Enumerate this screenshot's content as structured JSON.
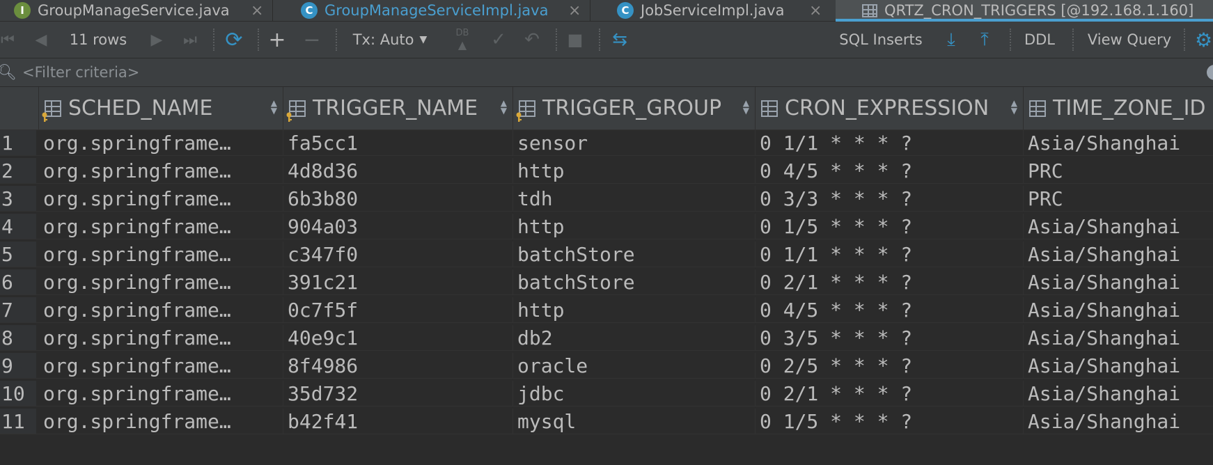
{
  "tabs": [
    {
      "badge": "I",
      "label": "GroupManageService.java"
    },
    {
      "badge": "C",
      "label": "GroupManageServiceImpl.java"
    },
    {
      "badge": "C",
      "label": "JobServiceImpl.java"
    },
    {
      "badge": "",
      "label": "QRTZ_CRON_TRIGGERS [@192.168.1.160]"
    }
  ],
  "toolbar": {
    "rows": "11 rows",
    "tx_mode": "Tx: Auto",
    "db_label": "DB",
    "sql_inserts": "SQL Inserts",
    "ddl": "DDL",
    "view_query": "View Query"
  },
  "filter": {
    "placeholder": "<Filter criteria>"
  },
  "columns": [
    "SCHED_NAME",
    "TRIGGER_NAME",
    "TRIGGER_GROUP",
    "CRON_EXPRESSION",
    "TIME_ZONE_ID"
  ],
  "rows": [
    {
      "n": "1",
      "cells": [
        "org.springframe…",
        "fa5cc1",
        "sensor",
        "0 1/1 * * * ?",
        "Asia/Shanghai"
      ]
    },
    {
      "n": "2",
      "cells": [
        "org.springframe…",
        "4d8d36",
        "http",
        "0 4/5 * * * ?",
        "PRC"
      ]
    },
    {
      "n": "3",
      "cells": [
        "org.springframe…",
        "6b3b80",
        "tdh",
        "0 3/3 * * * ?",
        "PRC"
      ]
    },
    {
      "n": "4",
      "cells": [
        "org.springframe…",
        "904a03",
        "http",
        "0 1/5 * * * ?",
        "Asia/Shanghai"
      ]
    },
    {
      "n": "5",
      "cells": [
        "org.springframe…",
        "c347f0",
        "batchStore",
        "0 1/1 * * * ?",
        "Asia/Shanghai"
      ]
    },
    {
      "n": "6",
      "cells": [
        "org.springframe…",
        "391c21",
        "batchStore",
        "0 2/1 * * * ?",
        "Asia/Shanghai"
      ]
    },
    {
      "n": "7",
      "cells": [
        "org.springframe…",
        "0c7f5f",
        "http",
        "0 4/5 * * * ?",
        "Asia/Shanghai"
      ]
    },
    {
      "n": "8",
      "cells": [
        "org.springframe…",
        "40e9c1",
        "db2",
        "0 3/5 * * * ?",
        "Asia/Shanghai"
      ]
    },
    {
      "n": "9",
      "cells": [
        "org.springframe…",
        "8f4986",
        "oracle",
        "0 2/5 * * * ?",
        "Asia/Shanghai"
      ]
    },
    {
      "n": "10",
      "cells": [
        "org.springframe…",
        "35d732",
        "jdbc",
        "0 2/1 * * * ?",
        "Asia/Shanghai"
      ]
    },
    {
      "n": "11",
      "cells": [
        "org.springframe…",
        "b42f41",
        "mysql",
        "0 1/5 * * * ?",
        "Asia/Shanghai"
      ]
    }
  ],
  "colors": {
    "accent": "#3592c4",
    "background": "#2b2b2b",
    "panel": "#3c3f41"
  }
}
